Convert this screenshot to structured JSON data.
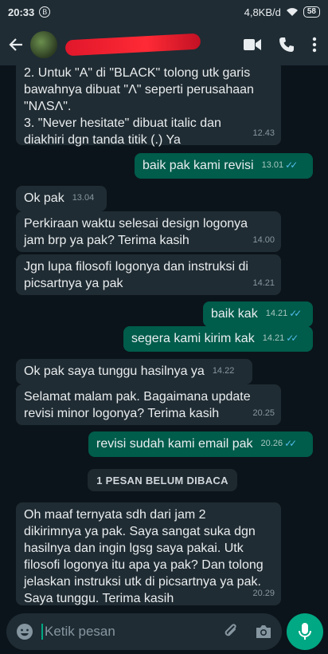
{
  "status_bar": {
    "time": "20:33",
    "indicator": "B",
    "network_speed": "4,8KB/d",
    "battery": "58"
  },
  "header": {
    "contact_name_redacted": true
  },
  "messages": [
    {
      "dir": "in",
      "text_lines": [
        "2. Untuk \"A\" di \"BLACK\" tolong utk garis",
        "bawahnya dibuat \"Λ\"  seperti perusahaan",
        "\"NΛSΛ\".",
        "3. \"Never hesitate\" dibuat italic dan",
        "diakhiri dgn tanda titik (.) Ya"
      ],
      "time": "12.43"
    },
    {
      "dir": "out",
      "text": "baik pak kami revisi",
      "time": "13.01"
    },
    {
      "dir": "in",
      "text": "Ok pak",
      "time": "13.04"
    },
    {
      "dir": "in",
      "text_lines": [
        "Perkiraan waktu selesai design logonya",
        "jam brp ya pak? Terima kasih"
      ],
      "time": "14.00"
    },
    {
      "dir": "in",
      "text_lines": [
        "Jgn lupa filosofi logonya dan instruksi di",
        "picsartnya ya pak"
      ],
      "time": "14.21"
    },
    {
      "dir": "out",
      "text": "baik kak",
      "time": "14.21"
    },
    {
      "dir": "out",
      "text": "segera kami kirim kak",
      "time": "14.21"
    },
    {
      "dir": "in",
      "text": "Ok pak saya tunggu hasilnya ya",
      "time": "14.22"
    },
    {
      "dir": "in",
      "text_lines": [
        "Selamat malam pak. Bagaimana update",
        "revisi minor logonya? Terima kasih"
      ],
      "time": "20.25"
    },
    {
      "dir": "out",
      "text": "revisi sudah kami email pak",
      "time": "20.26"
    },
    {
      "dir": "in",
      "text_lines": [
        "Oh maaf ternyata sdh dari jam 2",
        "dikirimnya ya pak. Saya sangat suka dgn",
        "hasilnya dan ingin lgsg saya pakai. Utk",
        "filosofi logonya itu apa ya pak? Dan tolong",
        "jelaskan instruksi utk di picsartnya ya pak.",
        "Saya tunggu. Terima kasih"
      ],
      "time": "20.29"
    }
  ],
  "unread_banner": "1 PESAN BELUM DIBACA",
  "input": {
    "placeholder": "Ketik pesan"
  },
  "icons": [
    "back-arrow-icon",
    "video-call-icon",
    "phone-icon",
    "more-vert-icon",
    "emoji-icon",
    "attach-icon",
    "camera-icon",
    "mic-icon",
    "double-check-icon"
  ],
  "colors": {
    "incoming_bubble": "#202c33",
    "outgoing_bubble": "#005c4b",
    "read_ticks": "#53bdeb",
    "accent": "#00a884",
    "background": "#0b141a",
    "redaction": "#e0172b"
  }
}
